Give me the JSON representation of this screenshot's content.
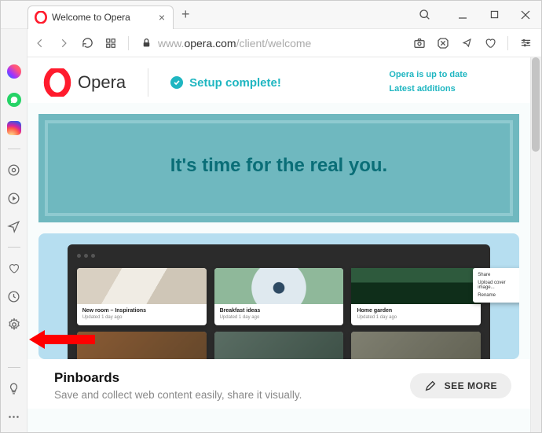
{
  "window": {
    "tab_title": "Welcome to Opera",
    "win_buttons": {
      "search": "search",
      "min": "minimize",
      "max": "maximize",
      "close": "close"
    }
  },
  "toolbar": {
    "url_pre": "www.",
    "url_domain": "opera.com",
    "url_path": "/client/welcome"
  },
  "sidebar": {
    "items": [
      "messenger",
      "whatsapp",
      "instagram",
      "separator",
      "pinboards-shortcut",
      "player",
      "send",
      "separator",
      "favorites",
      "history",
      "settings",
      "separator",
      "tips",
      "more"
    ]
  },
  "page": {
    "logo_text": "Opera",
    "setup_complete": "Setup complete!",
    "header_links": {
      "l1": "Opera is up to date",
      "l2": "Latest additions"
    },
    "hero": "It's time for the real you.",
    "pinboards": {
      "cards": [
        {
          "title": "New room – Inspirations",
          "sub": "Updated 1 day ago"
        },
        {
          "title": "Breakfast ideas",
          "sub": "Updated 1 day ago"
        },
        {
          "title": "Home garden",
          "sub": "Updated 1 day ago"
        }
      ],
      "context_menu": [
        "Share",
        "Upload cover image...",
        "Rename"
      ]
    },
    "section": {
      "title": "Pinboards",
      "desc": "Save and collect web content easily, share it visually.",
      "cta": "SEE MORE"
    }
  },
  "annotation": {
    "arrow_color": "#ff0000"
  }
}
